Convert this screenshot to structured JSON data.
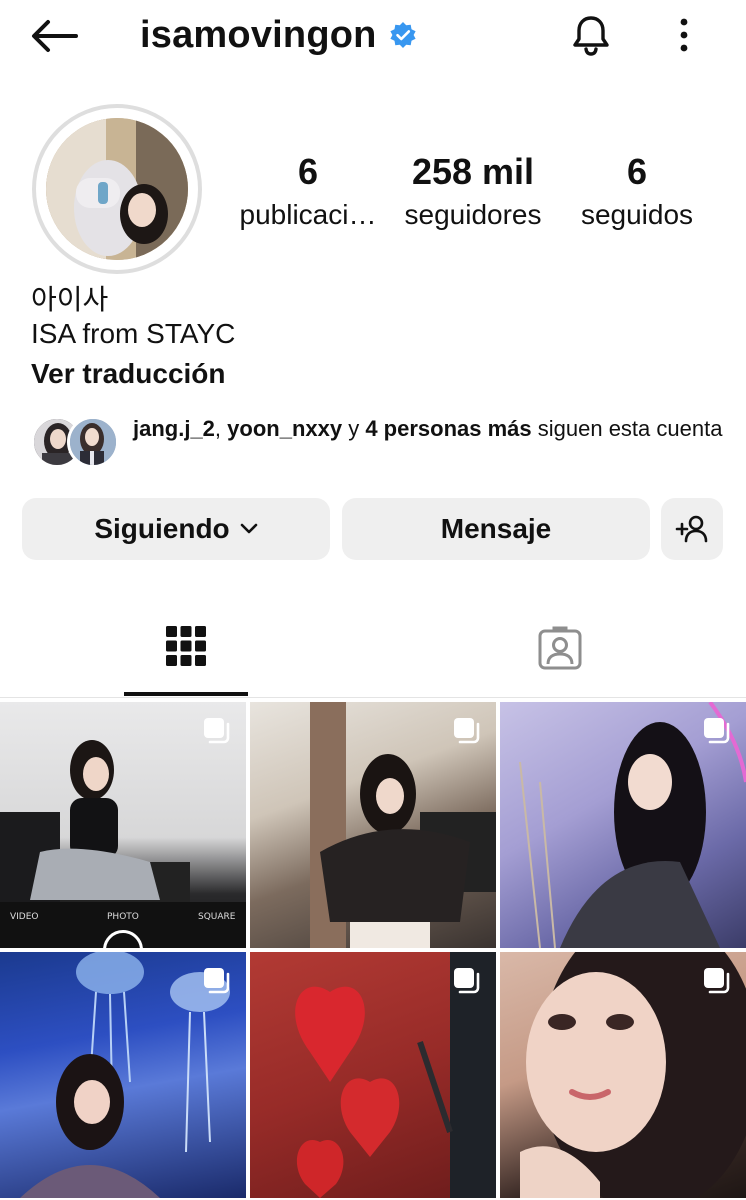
{
  "header": {
    "username": "isamovingon",
    "verified_icon": "verified-badge-icon",
    "accent": "#3897f0"
  },
  "profile": {
    "stats": [
      {
        "value": "6",
        "label": "publicaci…"
      },
      {
        "value": "258 mil",
        "label": "seguidores"
      },
      {
        "value": "6",
        "label": "seguidos"
      }
    ],
    "name": "아이사",
    "bio": "ISA from STAYC",
    "translate_link": "Ver traducción"
  },
  "followed_by": {
    "user1": "jang.j_2",
    "sep1": ", ",
    "user2": "yoon_nxxy",
    "mid": " y ",
    "others": "4 personas más",
    "tail": " siguen esta cuenta"
  },
  "actions": {
    "following_label": "Siguiendo",
    "message_label": "Mensaje"
  },
  "tabs": [
    "grid-icon",
    "tagged-icon"
  ],
  "posts": [
    {
      "type": "carousel",
      "cam_labels": [
        "VIDEO",
        "PHOTO",
        "SQUARE"
      ]
    },
    {
      "type": "carousel"
    },
    {
      "type": "carousel"
    },
    {
      "type": "carousel"
    },
    {
      "type": "carousel"
    },
    {
      "type": "carousel"
    }
  ]
}
